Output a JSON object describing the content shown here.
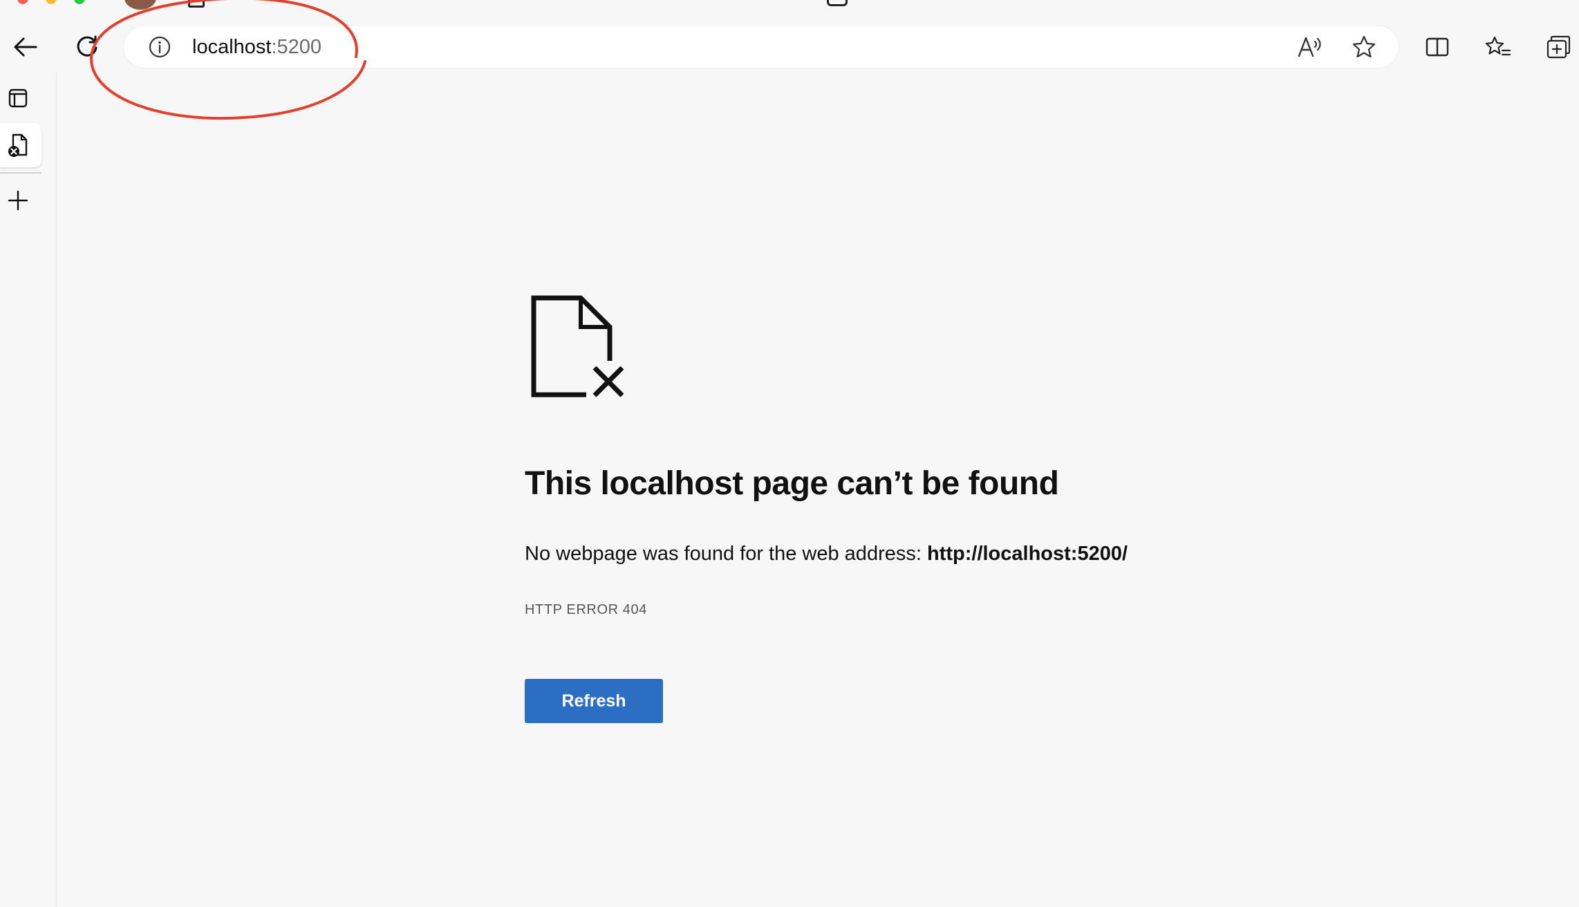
{
  "address_bar": {
    "host": "localhost",
    "port": ":5200"
  },
  "error_page": {
    "title": "This localhost page can’t be found",
    "description_prefix": "No webpage was found for the web address:",
    "url": "http://localhost:5200/",
    "error_code": "HTTP ERROR 404",
    "refresh_label": "Refresh"
  },
  "icons": {
    "back": "back-arrow-icon",
    "reload": "reload-icon",
    "site_info": "info-icon",
    "read_aloud": "read-aloud-icon",
    "favorite": "star-icon",
    "split_screen": "split-screen-icon",
    "favorites_list": "favorites-list-icon",
    "collections": "collections-icon",
    "tab_actions": "tab-actions-icon",
    "error_tab": "error-page-tab-icon",
    "new_tab": "plus-icon",
    "page_error": "file-broken-icon"
  },
  "colors": {
    "accent_button": "#2b6ec4",
    "annotation": "#e0402c",
    "page_background": "#f7f7f7"
  }
}
